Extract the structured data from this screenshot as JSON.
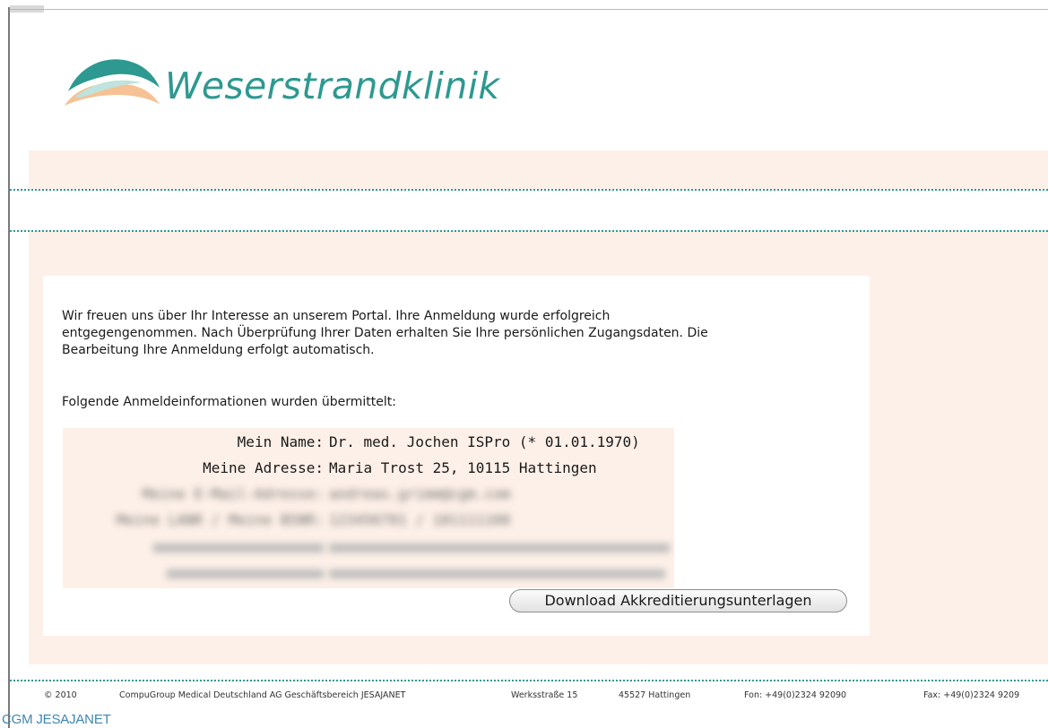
{
  "brand": {
    "name": "Weserstrandklinik",
    "color": "#2d9990"
  },
  "intro": {
    "line1": "Wir freuen uns über Ihr Interesse an unserem Portal. Ihre Anmeldung wurde erfolgreich",
    "line2": "entgegengenommen. Nach Überprüfung Ihrer Daten erhalten Sie Ihre persönlichen Zugangsdaten. Die",
    "line3": "Bearbeitung Ihre Anmeldung erfolgt automatisch."
  },
  "submitted_heading": "Folgende Anmeldeinformationen wurden übermittelt:",
  "registration": [
    {
      "label": "Mein Name:",
      "value": "Dr. med. Jochen ISPro (* 01.01.1970)"
    },
    {
      "label": "Meine Adresse:",
      "value": "Maria Trost 25, 10115 Hattingen"
    },
    {
      "label": "Meine E-Mail-Adresse:",
      "value": "andreas.grimm@cgm.com"
    },
    {
      "label": "Meine LANR / Meine BSNR:",
      "value": "123456701 / 181111100"
    }
  ],
  "download_button": "Download Akkreditierungsunterlagen",
  "footer": {
    "copyright": "© 2010",
    "company": "CompuGroup Medical Deutschland AG Geschäftsbereich JESAJANET",
    "street": "Werksstraße 15",
    "city": "45527 Hattingen",
    "phone": "Fon: +49(0)2324 92090",
    "fax": "Fax: +49(0)2324 9209"
  },
  "watermark": "CGM JESAJANET",
  "colors": {
    "accent": "#2d9990",
    "panel_bg": "#fdf0e8",
    "logo_peach": "#f6c295"
  }
}
